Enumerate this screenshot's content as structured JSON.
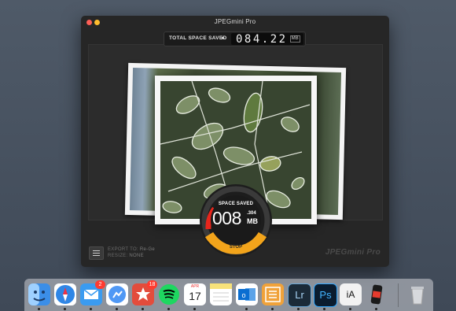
{
  "window": {
    "title": "JPEGmini Pro"
  },
  "total": {
    "label": "TOTAL SPACE SAVED",
    "arrow": "▸",
    "digits": "084.22",
    "unit": "MB"
  },
  "gauge": {
    "label": "SPACE SAVED",
    "digits": "008",
    "decimal": ".304",
    "unit": "MB",
    "stop_label": "STOP",
    "progress_fraction": 0.3
  },
  "export": {
    "to_key": "EXPORT TO:",
    "to_value": "Re-Ge",
    "resize_key": "RESIZE:",
    "resize_value": "NONE"
  },
  "brand": "JPEGmini Pro",
  "dock": {
    "items": [
      {
        "name": "finder",
        "icon": "finder-icon",
        "color": "#3b8ee8"
      },
      {
        "name": "safari",
        "icon": "compass-icon",
        "color": "#2f86e6"
      },
      {
        "name": "mail",
        "icon": "envelope-icon",
        "color": "#3a9bf0",
        "badge": "2"
      },
      {
        "name": "messenger",
        "icon": "paper-plane-icon",
        "color": "#4f98f5"
      },
      {
        "name": "wunderlist",
        "icon": "star-icon",
        "color": "#e34c3c",
        "badge": "18"
      },
      {
        "name": "spotify",
        "icon": "spotify-icon",
        "color": "#1ed760"
      },
      {
        "name": "calendar",
        "icon": "calendar-icon",
        "color": "#ffffff",
        "day": "17",
        "month": "APR"
      },
      {
        "name": "notes",
        "icon": "notes-icon",
        "color": "#f7e27a"
      },
      {
        "name": "outlook",
        "icon": "outlook-icon",
        "color": "#0a6ed1"
      },
      {
        "name": "omnifocus",
        "icon": "checklist-icon",
        "color": "#f0a23a"
      },
      {
        "name": "lightroom",
        "icon": "lightroom-icon",
        "color": "#1b2a38",
        "text": "Lr"
      },
      {
        "name": "photoshop",
        "icon": "photoshop-icon",
        "color": "#0a1c2f",
        "text": "Ps"
      },
      {
        "name": "ia-writer",
        "icon": "ia-writer-icon",
        "color": "#f2f2f2",
        "text": "iA"
      },
      {
        "name": "jpegmini",
        "icon": "jpegmini-icon",
        "color": "#1a1a1a"
      },
      {
        "name": "trash",
        "icon": "trash-icon",
        "color": "#d7d9dd"
      }
    ]
  }
}
